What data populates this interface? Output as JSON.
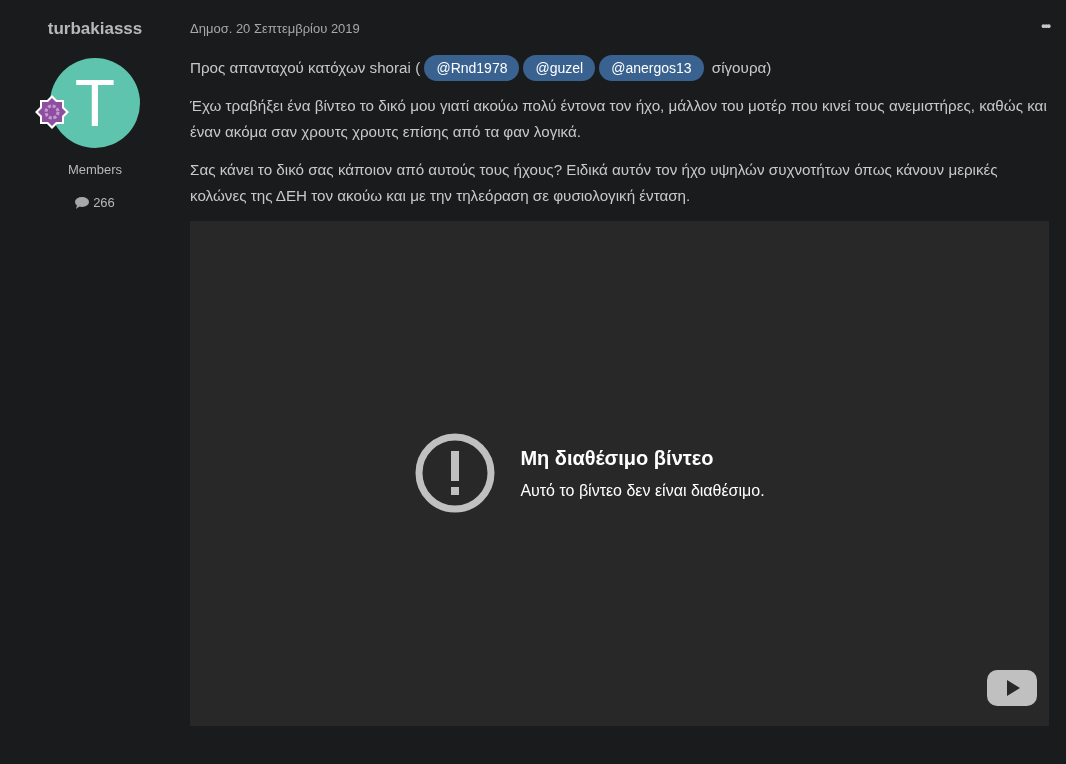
{
  "author": {
    "name": "turbakiasss",
    "avatar_letter": "T",
    "group": "Members",
    "post_count": "266"
  },
  "post": {
    "date": "Δημοσ. 20 Σεπτεμβρίου 2019",
    "menu": "•••",
    "paragraphs": [
      {
        "parts": [
          {
            "kind": "text",
            "text": "Προς απανταχού κατόχων shorai ( "
          },
          {
            "kind": "mention",
            "text": "@Rnd1978"
          },
          {
            "kind": "mention",
            "text": "@guzel"
          },
          {
            "kind": "mention",
            "text": "@anergos13"
          },
          {
            "kind": "text",
            "text": " σίγουρα)"
          }
        ]
      },
      {
        "parts": [
          {
            "kind": "text",
            "text": "Έχω τραβήξει ένα βίντεο το δικό μου γιατί ακούω πολύ έντονα τον ήχο, μάλλον του μοτέρ που κινεί τους ανεμιστήρες, καθώς και έναν ακόμα σαν χρουτς χρουτς επίσης από τα φαν λογικά."
          }
        ]
      },
      {
        "parts": [
          {
            "kind": "text",
            "text": "Σας κάνει το δικό σας κάποιον από αυτούς τους ήχους? Ειδικά αυτόν τον ήχο υψηλών συχνοτήτων όπως κάνουν μερικές κολώνες της ΔΕΗ τον ακούω και με την τηλεόραση σε φυσιολογική ένταση."
          }
        ]
      }
    ],
    "video": {
      "title": "Μη διαθέσιμο βίντεο",
      "message": "Αυτό το βίντεο δεν είναι διαθέσιμο."
    }
  }
}
